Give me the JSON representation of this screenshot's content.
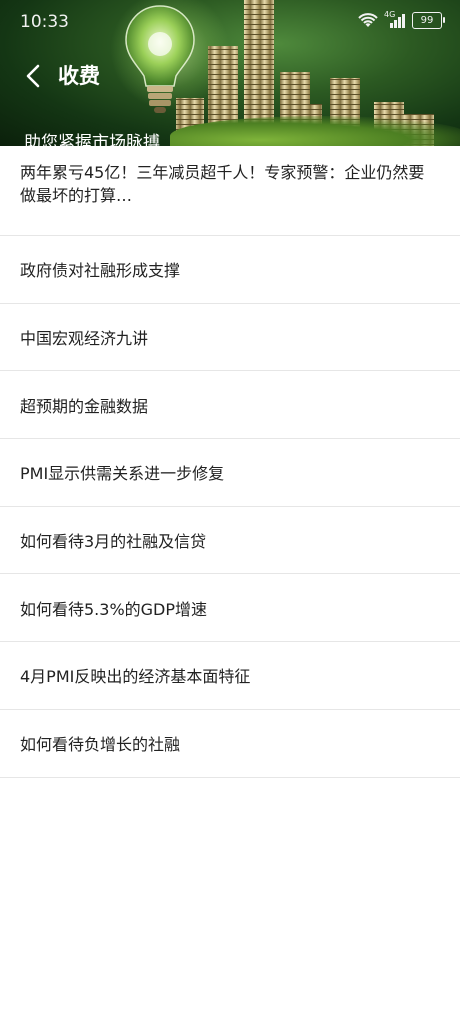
{
  "status_bar": {
    "time": "10:33",
    "network": "4G",
    "battery": "99"
  },
  "nav": {
    "back_icon": "chevron-left-icon",
    "title": "收费"
  },
  "header": {
    "subtitle": "助您紧握市场脉搏",
    "accent": "#2c5a22"
  },
  "articles": [
    {
      "title": "两年累亏45亿！三年减员超千人！专家预警：企业仍然要做最坏的打算…"
    },
    {
      "title": "政府债对社融形成支撑"
    },
    {
      "title": "中国宏观经济九讲"
    },
    {
      "title": "超预期的金融数据"
    },
    {
      "title": "PMI显示供需关系进一步修复"
    },
    {
      "title": "如何看待3月的社融及信贷"
    },
    {
      "title": "如何看待5.3%的GDP增速"
    },
    {
      "title": "4月PMI反映出的经济基本面特征"
    },
    {
      "title": "如何看待负增长的社融"
    }
  ]
}
